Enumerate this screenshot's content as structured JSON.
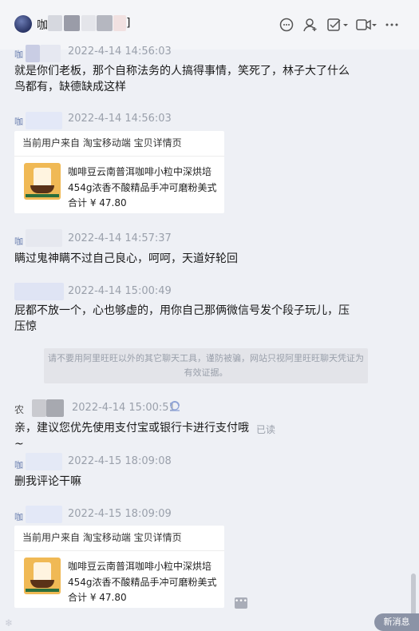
{
  "header": {
    "title_prefix": "咖",
    "title_suffix": "]",
    "icons": [
      "chat-bubble-icon",
      "contact-icon",
      "task-check-icon",
      "video-icon",
      "more-icon"
    ]
  },
  "messages": [
    {
      "sender": "咖",
      "time": "2022-4-14 14:56:03",
      "text": "就是你们老板，那个自称法务的人搞得事情，笑死了，林子大了什么鸟都有，缺德缺成这样"
    },
    {
      "sender": "咖",
      "time": "2022-4-14 14:56:03",
      "card": {
        "header": "当前用户来自 淘宝移动端 宝贝详情页",
        "product": "咖啡豆云南普洱咖啡小粒中深烘培454g浓香不酸精品手冲可磨粉美式",
        "price": "合计 ¥ 47.80"
      }
    },
    {
      "sender": "咖",
      "time": "2022-4-14 14:57:37",
      "text": "瞒过鬼神瞒不过自己良心，呵呵，天道好轮回"
    },
    {
      "sender": "",
      "time": "2022-4-14 15:00:49",
      "text": "屁都不放一个，心也够虚的，用你自己那俩微信号发个段子玩儿，压压惊"
    },
    {
      "sender": "农",
      "time": "2022-4-14 15:00:51",
      "text": "亲，建议您优先使用支付宝或银行卡进行支付哦~",
      "status": "已读"
    },
    {
      "sender": "咖",
      "time": "2022-4-15 18:09:08",
      "text": "删我评论干嘛"
    },
    {
      "sender": "咖",
      "time": "2022-4-15 18:09:09",
      "card": {
        "header": "当前用户来自 淘宝移动端 宝贝详情页",
        "product": "咖啡豆云南普洱咖啡小粒中深烘培454g浓香不酸精品手冲可磨粉美式",
        "price": "合计 ¥ 47.80"
      }
    }
  ],
  "notice": "请不要用阿里旺旺以外的其它聊天工具，谨防被骗，网站只视阿里旺旺聊天凭证为有效证据。",
  "new_message_label": "新消息"
}
